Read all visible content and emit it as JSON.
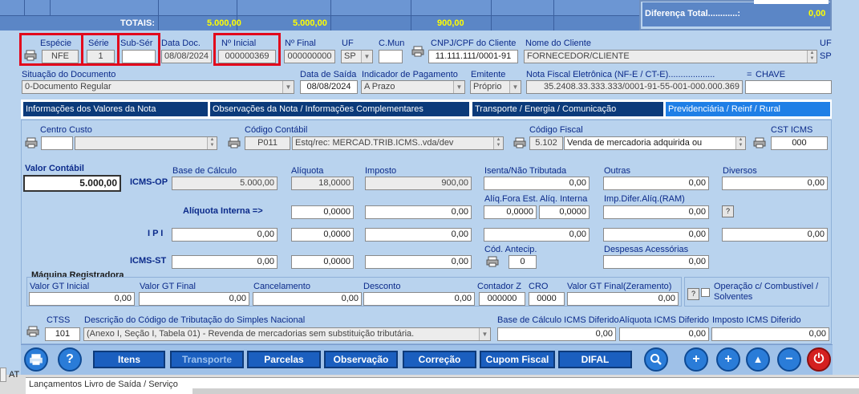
{
  "totals": {
    "label": "TOTAIS:",
    "values": [
      "5.000,00",
      "5.000,00",
      "900,00"
    ],
    "difference_label": "Diferença Total............:",
    "difference_value": "0,00"
  },
  "header": {
    "especie_label": "Espécie",
    "especie_value": "NFE",
    "serie_label": "Série",
    "serie_value": "1",
    "subserie_label": "Sub-Sér",
    "subserie_value": "",
    "data_doc_label": "Data Doc.",
    "data_doc_value": "08/08/2024",
    "n_inicial_label": "Nº Inicial",
    "n_inicial_value": "000000369",
    "n_final_label": "Nº Final",
    "n_final_value": "000000000",
    "uf_label": "UF",
    "uf_value": "SP",
    "cmun_label": "C.Mun",
    "cmun_value": "",
    "cnpj_label": "CNPJ/CPF do Cliente",
    "cnpj_value": "11.111.111/0001-91",
    "nome_label": "Nome do Cliente",
    "nome_value": "FORNECEDOR/CLIENTE",
    "uf2_label": "UF",
    "uf2_value": "SP"
  },
  "row2": {
    "situacao_label": "Situação do Documento",
    "situacao_value": "0-Documento Regular",
    "data_saida_label": "Data de Saída",
    "data_saida_value": "08/08/2024",
    "pagamento_label": "Indicador de Pagamento",
    "pagamento_value": "A Prazo",
    "emitente_label": "Emitente",
    "emitente_value": "Próprio",
    "chave_label": "Nota Fiscal Eletrônica (NF-E / CT-E)...................",
    "chave_value": "35.2408.33.333.333/0001-91-55-001-000.000.369",
    "eq_label": "=",
    "chave2_label": "CHAVE",
    "chave2_value": ""
  },
  "tabs": [
    {
      "label": "Informações dos Valores da Nota"
    },
    {
      "label": "Observações da Nota / Informações Complementares"
    },
    {
      "label": "Transporte / Energia / Comunicação"
    },
    {
      "label": "Previdenciária / Reinf / Rural"
    }
  ],
  "codes": {
    "centro_custo_label": "Centro Custo",
    "centro_custo_value": "",
    "centro_custo_desc": "",
    "codigo_contabil_label": "Código Contábil",
    "codigo_contabil_value": "P011",
    "codigo_contabil_desc": "Estq/rec: MERCAD.TRIB.ICMS..vda/dev",
    "codigo_fiscal_label": "Código Fiscal",
    "codigo_fiscal_value": "5.102",
    "codigo_fiscal_desc": "Venda de mercadoria adquirida ou",
    "cst_label": "CST ICMS",
    "cst_value": "000"
  },
  "values": {
    "valor_contabil_label": "Valor Contábil",
    "valor_contabil_value": "5.000,00",
    "icms_op_label": "ICMS-OP",
    "base_label": "Base de Cálculo",
    "base_value": "5.000,00",
    "aliquota_label": "Alíquota",
    "aliquota_value": "18,0000",
    "imposto_label": "Imposto",
    "imposto_value": "900,00",
    "isenta_label": "Isenta/Não Tributada",
    "isenta_value": "0,00",
    "outras_label": "Outras",
    "outras_value": "0,00",
    "diversos_label": "Diversos",
    "diversos_value": "0,00",
    "aliq_interna_label": "Alíquota Interna =>",
    "aliq_interna_value": "0,0000",
    "aliq_interna_imposto": "0,00",
    "aliq_fora_label": "Alíq.Fora Est.",
    "aliq_fora_value": "0,0000",
    "aliq_int_label": "Alíq. Interna",
    "aliq_int_value": "0,0000",
    "imp_difer_label": "Imp.Difer.Alíq.(RAM)",
    "imp_difer_value": "0,00",
    "ipi_label": "I P I",
    "ipi_base": "0,00",
    "ipi_aliq": "0,0000",
    "ipi_imposto": "0,00",
    "ipi_isenta": "0,00",
    "ipi_outras": "0,00",
    "ipi_diversos": "0,00",
    "icms_st_label": "ICMS-ST",
    "st_base": "0,00",
    "st_aliq": "0,0000",
    "st_imposto": "0,00",
    "cod_antecip_label": "Cód. Antecip.",
    "cod_antecip_value": "0",
    "despesas_label": "Despesas Acessórias",
    "despesas_value": "0,00"
  },
  "maquina": {
    "title": "Máquina Registradora",
    "gt_inicial_label": "Valor GT Inicial",
    "gt_inicial_value": "0,00",
    "gt_final_label": "Valor GT Final",
    "gt_final_value": "0,00",
    "cancelamento_label": "Cancelamento",
    "cancelamento_value": "0,00",
    "desconto_label": "Desconto",
    "desconto_value": "0,00",
    "contador_label": "Contador Z",
    "contador_value": "000000",
    "cro_label": "CRO",
    "cro_value": "0000",
    "gt_zerado_label": "Valor GT Final(Zeramento)",
    "gt_zerado_value": "0,00",
    "combustivel_label": "Operação c/ Combustível / Solventes"
  },
  "ctss": {
    "label": "CTSS",
    "value": "101",
    "desc_label": "Descrição do Código de Tributação do Simples Nacional",
    "desc_value": "(Anexo I, Seção I, Tabela 01) - Revenda de mercadorias sem substituição tributária.",
    "base_dif_label": "Base de Cálculo ICMS Diferido",
    "base_dif_value": "0,00",
    "aliq_dif_label": "Alíquota ICMS Diferido",
    "aliq_dif_value": "0,00",
    "imp_dif_label": "Imposto ICMS Diferido",
    "imp_dif_value": "0,00"
  },
  "toolbar": {
    "itens": "Itens",
    "transporte": "Transporte",
    "parcelas": "Parcelas",
    "observacao": "Observação",
    "correcao": "Correção",
    "cupom": "Cupom Fiscal",
    "difal": "DIFAL",
    "help": "?"
  },
  "footer": {
    "at_text": "AT",
    "status_text": "Lançamentos Livro de Saída / Serviço"
  },
  "colors": {
    "accent": "#1b5fbf",
    "highlight": "#e2071c",
    "totals_text": "#ffff00"
  }
}
